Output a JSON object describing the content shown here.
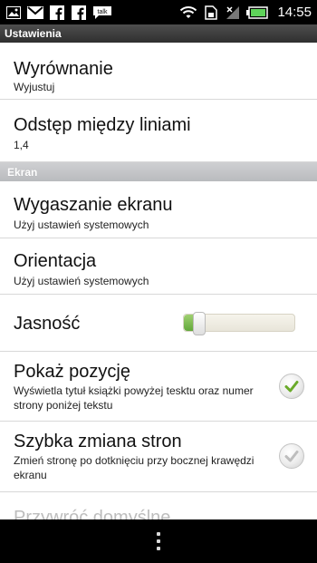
{
  "status_bar": {
    "time": "14:55",
    "left_icons": [
      "image-icon",
      "gmail-icon",
      "facebook-icon",
      "facebook-icon",
      "talk-icon"
    ],
    "talk_label": "talk",
    "battery_color": "#5fd35a"
  },
  "title_bar": {
    "title": "Ustawienia"
  },
  "settings": {
    "alignment": {
      "title": "Wyrównanie",
      "value": "Wyjustuj"
    },
    "line_spacing": {
      "title": "Odstęp między liniami",
      "value": "1,4"
    },
    "section_screen": "Ekran",
    "screen_timeout": {
      "title": "Wygaszanie ekranu",
      "value": "Użyj ustawień systemowych"
    },
    "orientation": {
      "title": "Orientacja",
      "value": "Użyj ustawień systemowych"
    },
    "brightness": {
      "title": "Jasność",
      "level": 0.08
    },
    "show_position": {
      "title": "Pokaż pozycję",
      "description": "Wyświetla tytuł książki powyżej tesktu oraz numer strony poniżej tekstu",
      "checked": true
    },
    "quick_page_turn": {
      "title": "Szybka zmiana stron",
      "description": "Zmień stronę po dotknięciu przy bocznej krawędzi ekranu",
      "checked": false
    },
    "restore_defaults": {
      "title": "Przywróć domyślne"
    }
  },
  "colors": {
    "check_green": "#6aaa2a",
    "check_grey": "#bdbdbd"
  }
}
